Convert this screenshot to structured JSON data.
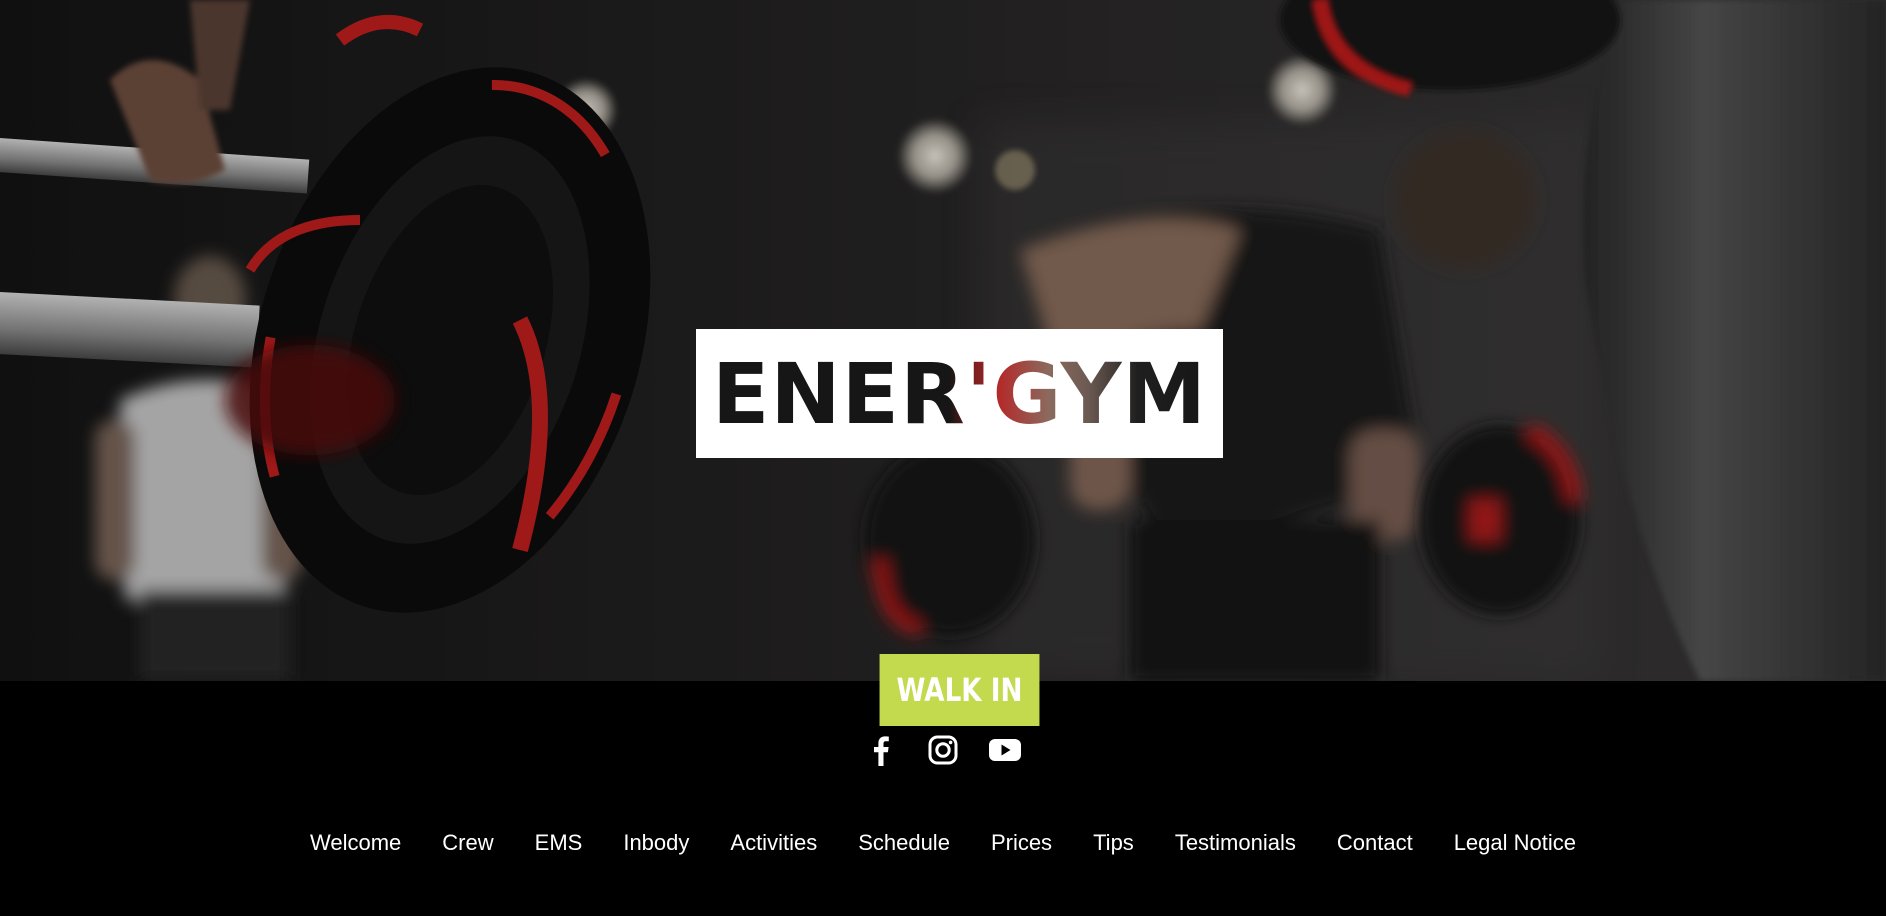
{
  "hero": {
    "logo_text": "ENER'GYM"
  },
  "cta": {
    "label": "WALK IN"
  },
  "social": [
    {
      "icon": "facebook-icon"
    },
    {
      "icon": "instagram-icon"
    },
    {
      "icon": "youtube-icon"
    }
  ],
  "nav": {
    "items": [
      {
        "label": "Welcome"
      },
      {
        "label": "Crew"
      },
      {
        "label": "EMS"
      },
      {
        "label": "Inbody"
      },
      {
        "label": "Activities"
      },
      {
        "label": "Schedule"
      },
      {
        "label": "Prices"
      },
      {
        "label": "Tips"
      },
      {
        "label": "Testimonials"
      },
      {
        "label": "Contact"
      },
      {
        "label": "Legal Notice"
      }
    ]
  },
  "colors": {
    "accent": "#c3d94e",
    "footer_bg": "#000000",
    "logo_box": "#ffffff",
    "plate_red": "#c21f1f"
  }
}
